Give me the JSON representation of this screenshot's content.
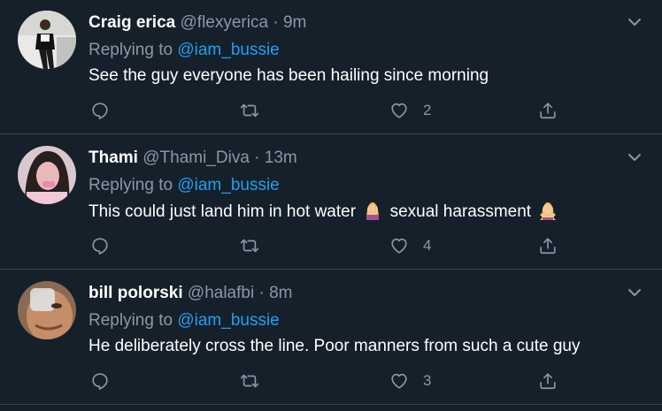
{
  "tweets": [
    {
      "name": "Craig erica",
      "handle": "@flexyerica",
      "dot": "·",
      "time": "9m",
      "replying_prefix": "Replying to",
      "replying_to": "@iam_bussie",
      "text": "See the guy everyone has been hailing since morning",
      "like_count": "2",
      "avatar_icon": "avatar-photo-standing-person"
    },
    {
      "name": "Thami",
      "handle": "@Thami_Diva",
      "dot": "·",
      "time": "13m",
      "replying_prefix": "Replying to",
      "replying_to": "@iam_bussie",
      "text_before": "This could just land him in hot water",
      "text_after": "sexual harassment",
      "emoji_1": "woman-facepalming-emoji",
      "emoji_2": "woman-gesturing-no-emoji",
      "like_count": "4",
      "avatar_icon": "avatar-photo-woman-selfie"
    },
    {
      "name": "bill polorski",
      "handle": "@halafbi",
      "dot": "·",
      "time": "8m",
      "replying_prefix": "Replying to",
      "replying_to": "@iam_bussie",
      "text": "He deliberately cross the line. Poor manners from such a cute guy",
      "like_count": "3",
      "avatar_icon": "avatar-photo-face-closeup"
    }
  ],
  "colors": {
    "background": "#15202b",
    "secondary_text": "#8899a6",
    "link": "#1da1f2",
    "divider": "#38444d"
  }
}
